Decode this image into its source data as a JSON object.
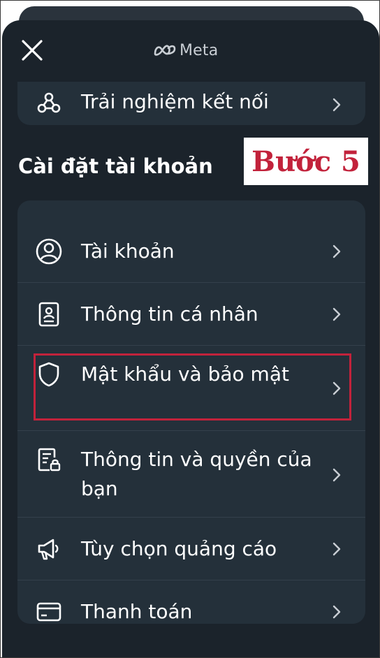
{
  "header": {
    "brand": "Meta"
  },
  "top_card": {
    "item_label": "Trải nghiệm kết nối"
  },
  "section": {
    "title": "Cài đặt tài khoản"
  },
  "step_label": "Bước 5",
  "settings": {
    "items": [
      {
        "label": "Tài khoản",
        "icon": "account-circle-icon"
      },
      {
        "label": "Thông tin cá nhân",
        "icon": "id-card-icon"
      },
      {
        "label": "Mật khẩu và bảo mật",
        "icon": "shield-icon"
      },
      {
        "label": "Thông tin và quyền của bạn",
        "icon": "document-lock-icon"
      },
      {
        "label": "Tùy chọn quảng cáo",
        "icon": "megaphone-icon"
      },
      {
        "label": "Thanh toán",
        "icon": "credit-card-icon"
      }
    ]
  },
  "colors": {
    "sheet_bg": "#1b232b",
    "card_bg": "#24303a",
    "text": "#ffffff",
    "highlight": "#c2223b"
  }
}
